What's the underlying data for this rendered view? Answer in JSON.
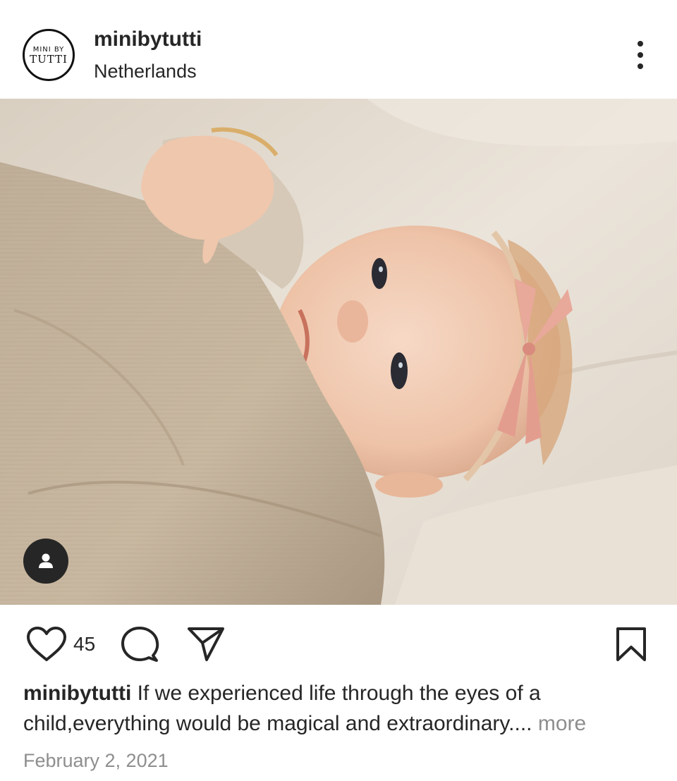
{
  "post": {
    "username": "minibytutti",
    "location": "Netherlands",
    "avatar_logo_top": "MINI BY",
    "avatar_logo_bottom": "TUTTI",
    "like_count": "45",
    "caption_username": "minibytutti",
    "caption_text": "If we experienced life through the eyes of a child,everything would be magical and extraordinary....",
    "caption_more": "more",
    "date": "February 2, 2021"
  },
  "icons": {
    "more": "more-options-icon",
    "like": "heart-icon",
    "comment": "comment-bubble-icon",
    "share": "paper-plane-icon",
    "save": "bookmark-icon",
    "tag": "person-tag-icon"
  },
  "colors": {
    "text": "#262626",
    "muted": "#8e8e8e",
    "background": "#ffffff"
  }
}
